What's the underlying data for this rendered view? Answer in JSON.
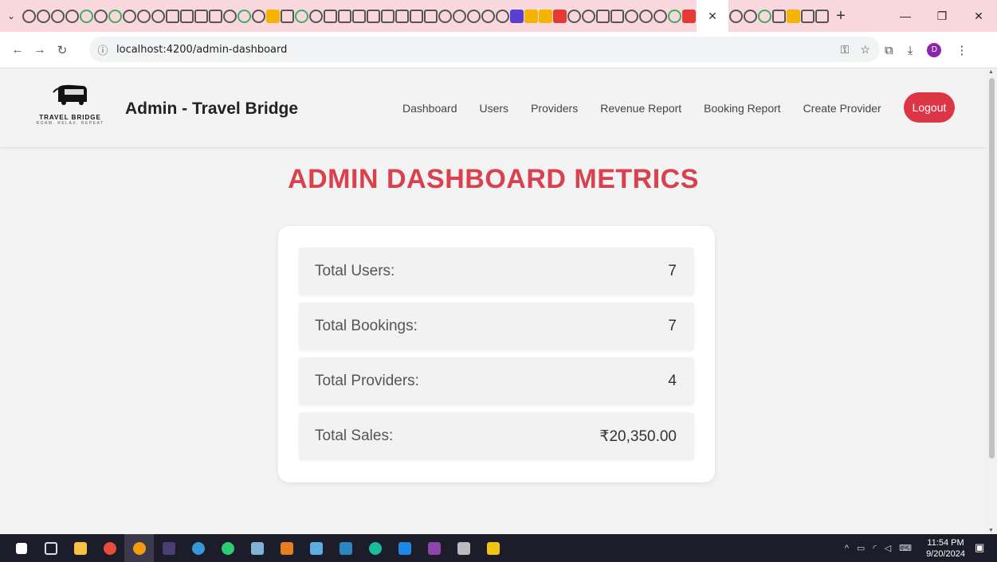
{
  "browser": {
    "url": "localhost:4200/admin-dashboard",
    "profile_initial": "D"
  },
  "header": {
    "logo_name": "TRAVEL BRIDGE",
    "logo_tagline": "ROAM. RELAX. REPEAT",
    "brand_title": "Admin - Travel Bridge",
    "nav": [
      {
        "label": "Dashboard"
      },
      {
        "label": "Users"
      },
      {
        "label": "Providers"
      },
      {
        "label": "Revenue Report"
      },
      {
        "label": "Booking Report"
      },
      {
        "label": "Create Provider"
      }
    ],
    "logout_label": "Logout"
  },
  "main": {
    "title": "ADMIN DASHBOARD METRICS",
    "metrics": [
      {
        "label": "Total Users:",
        "value": "7"
      },
      {
        "label": "Total Bookings:",
        "value": "7"
      },
      {
        "label": "Total Providers:",
        "value": "4"
      },
      {
        "label": "Total Sales:",
        "value": "₹20,350.00"
      }
    ]
  },
  "taskbar": {
    "time": "11:54 PM",
    "date": "9/20/2024"
  },
  "colors": {
    "accent": "#d9414f",
    "logout": "#dc3545",
    "tabstrip": "#f8d7dd"
  }
}
